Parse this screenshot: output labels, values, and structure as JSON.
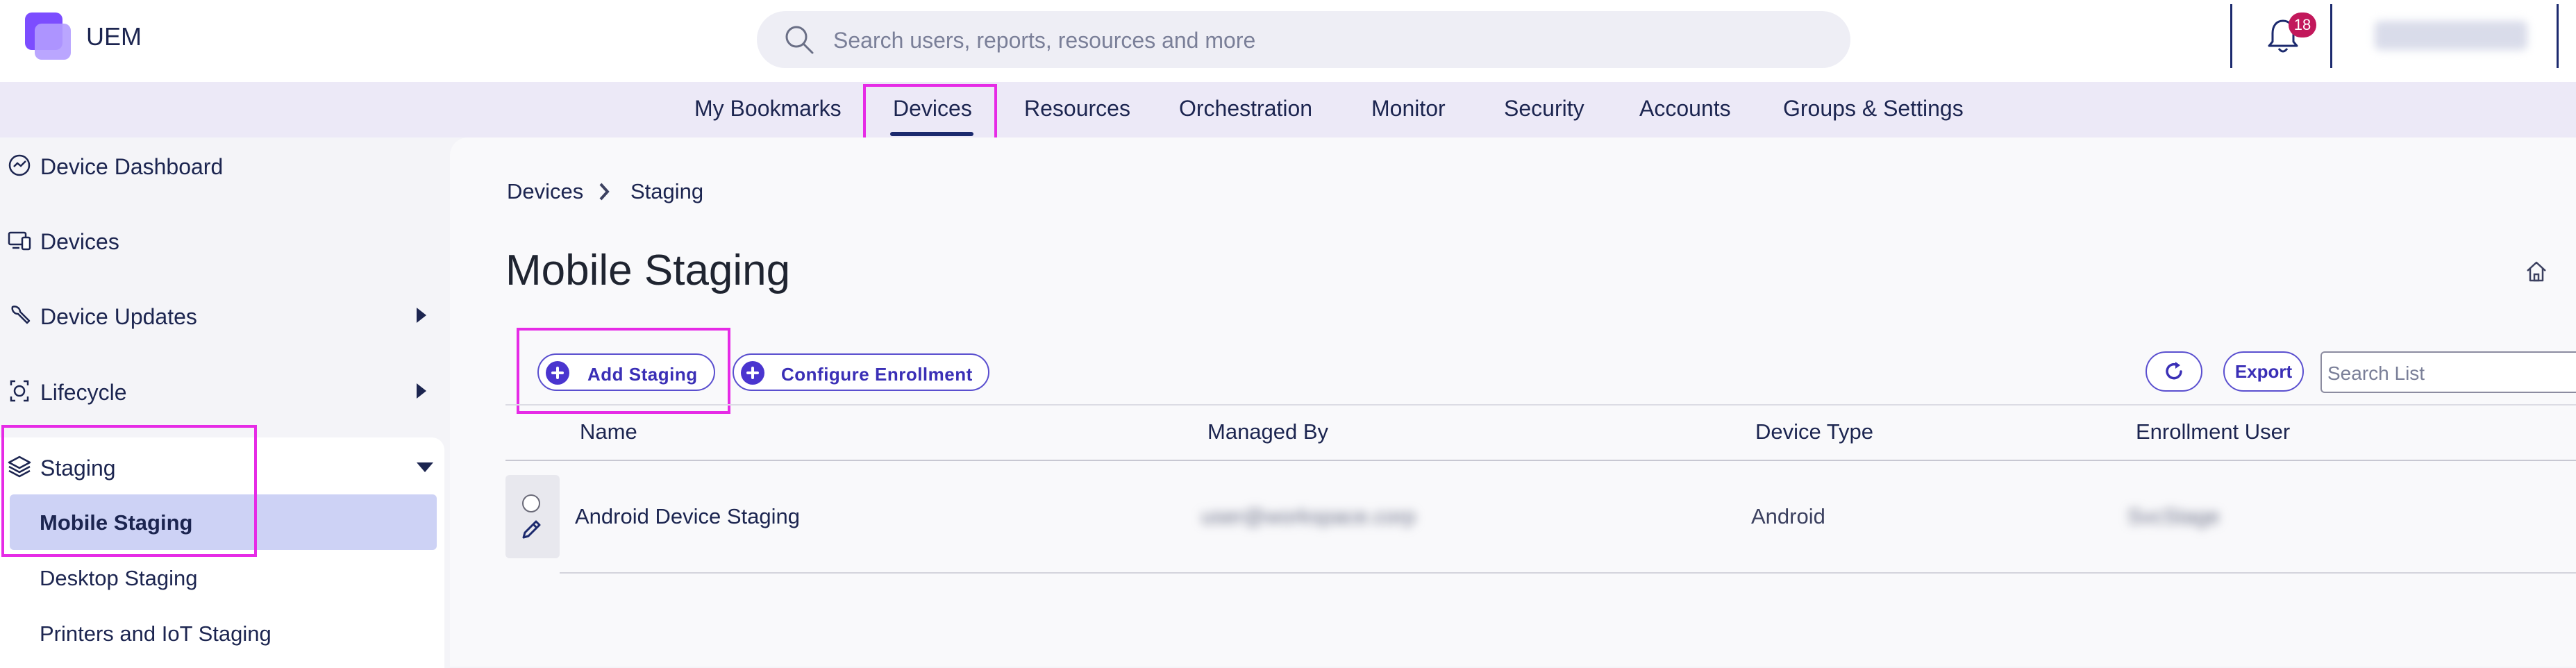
{
  "header": {
    "app_name": "UEM",
    "search_placeholder": "Search users, reports, resources and more",
    "notification_count": "18",
    "icons": {
      "logo": "uem-logo",
      "search": "search-icon",
      "bell": "bell-icon"
    }
  },
  "nav": {
    "items": [
      "My Bookmarks",
      "Devices",
      "Resources",
      "Orchestration",
      "Monitor",
      "Security",
      "Accounts",
      "Groups & Settings"
    ],
    "active": "Devices"
  },
  "sidebar": {
    "items": [
      {
        "label": "Device Dashboard",
        "icon": "dashboard-icon"
      },
      {
        "label": "Devices",
        "icon": "devices-icon"
      },
      {
        "label": "Device Updates",
        "icon": "wrench-icon",
        "expandable": true
      },
      {
        "label": "Lifecycle",
        "icon": "lifecycle-icon",
        "expandable": true
      },
      {
        "label": "Staging",
        "icon": "layers-icon",
        "expanded": true
      }
    ],
    "sub_items": [
      "Mobile Staging",
      "Desktop Staging",
      "Printers and IoT Staging"
    ],
    "active_sub_item": "Mobile Staging"
  },
  "breadcrumb": {
    "parent": "Devices",
    "current": "Staging"
  },
  "page_title": "Mobile Staging",
  "toolbar": {
    "add_staging": "Add Staging",
    "configure_enrollment": "Configure Enrollment",
    "export": "Export",
    "search_list_placeholder": "Search List"
  },
  "table": {
    "columns": [
      "Name",
      "Managed By",
      "Device Type",
      "Enrollment User"
    ],
    "rows": [
      {
        "name": "Android Device Staging",
        "managed_by": "user@workspace.corp",
        "device_type": "Android",
        "enrollment_user": "SvcStage"
      }
    ]
  },
  "colors": {
    "accent": "#4a35cf",
    "nav_bg": "#ece9f7",
    "highlight": "#e62be6",
    "active_sub_bg": "#cdd2f5",
    "badge": "#c2185b"
  }
}
